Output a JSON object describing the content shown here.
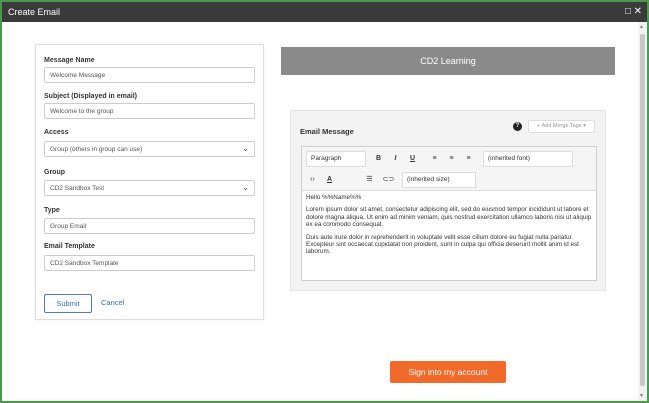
{
  "window": {
    "title": "Create Email",
    "maximize_icon": "maximize-icon",
    "close_icon": "close-icon"
  },
  "form": {
    "message_name": {
      "label": "Message Name",
      "value": "Welcome Message"
    },
    "subject": {
      "label": "Subject (Displayed in email)",
      "value": "Welcome to the group"
    },
    "access": {
      "label": "Access",
      "value": "Group (others in group can use)"
    },
    "group": {
      "label": "Group",
      "value": "CD2 Sandbox Test"
    },
    "type": {
      "label": "Type",
      "value": "Group Email"
    },
    "template": {
      "label": "Email Template",
      "value": "CD2 Sandbox Template"
    },
    "submit_label": "Submit",
    "cancel_label": "Cancel"
  },
  "preview": {
    "header": "CD2 Learning",
    "email_message_label": "Email Message",
    "help_icon": "?",
    "merge_tags_label": "+ Add Merge Tags ▾",
    "toolbar": {
      "paragraph": "Paragraph",
      "bold": "B",
      "italic": "I",
      "underline": "U",
      "font": "(inherited font)",
      "size": "(inherited size)"
    },
    "body": {
      "greeting": "Hello %%Name%%",
      "para1": "Lorem ipsum dolor sit amet, consectetur adipiscing elit, sed do eiusmod tempor incididunt ut labore et dolore magna aliqua. Ut enim ad minim veniam, quis nostrud exercitation ullamco laboris nisi ut aliquip ex ea commodo consequat.",
      "para2": "Duis aute irure dolor in reprehenderit in voluptate velit esse cillum dolore eu fugiat nulla pariatur. Excepteur sint occaecat cupidatat non proident, sunt in culpa qui officia deserunt mollit anim id est laborum."
    },
    "signin_label": "Sign into my account"
  },
  "colors": {
    "titlebar": "#3a3a3a",
    "frame_border": "#4a9a4a",
    "preview_header": "#8a8a8a",
    "signin_button": "#f26a2a",
    "link": "#3a6bc5"
  }
}
